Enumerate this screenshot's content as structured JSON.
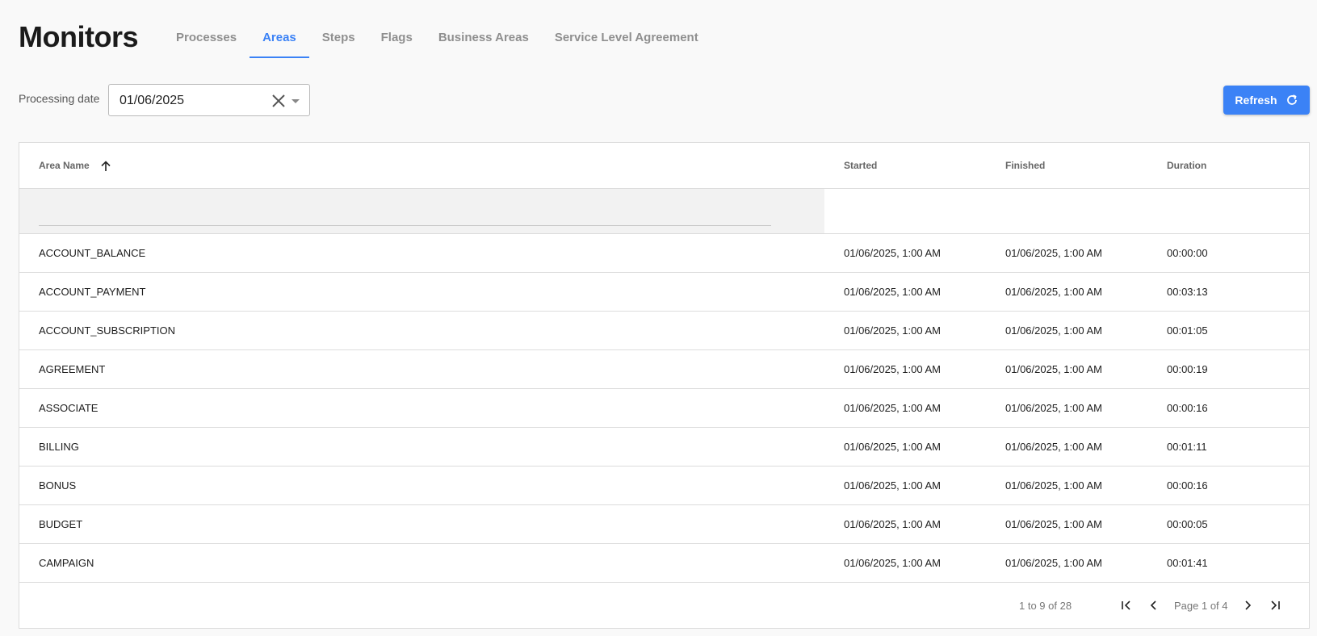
{
  "page": {
    "title": "Monitors"
  },
  "tabs": [
    {
      "label": "Processes"
    },
    {
      "label": "Areas",
      "active": true
    },
    {
      "label": "Steps"
    },
    {
      "label": "Flags"
    },
    {
      "label": "Business Areas"
    },
    {
      "label": "Service Level Agreement"
    }
  ],
  "filter": {
    "label": "Processing date",
    "value": "01/06/2025"
  },
  "refresh": {
    "label": "Refresh",
    "icon": "refresh-icon"
  },
  "colors": {
    "accent": "#3b82f6"
  },
  "grid": {
    "columns": [
      {
        "label": "Area Name",
        "sort": "ascending"
      },
      {
        "label": "Started"
      },
      {
        "label": "Finished"
      },
      {
        "label": "Duration"
      }
    ],
    "rows": [
      {
        "name": "ACCOUNT_BALANCE",
        "started": "01/06/2025, 1:00 AM",
        "finished": "01/06/2025, 1:00 AM",
        "duration": "00:00:00"
      },
      {
        "name": "ACCOUNT_PAYMENT",
        "started": "01/06/2025, 1:00 AM",
        "finished": "01/06/2025, 1:00 AM",
        "duration": "00:03:13"
      },
      {
        "name": "ACCOUNT_SUBSCRIPTION",
        "started": "01/06/2025, 1:00 AM",
        "finished": "01/06/2025, 1:00 AM",
        "duration": "00:01:05"
      },
      {
        "name": "AGREEMENT",
        "started": "01/06/2025, 1:00 AM",
        "finished": "01/06/2025, 1:00 AM",
        "duration": "00:00:19"
      },
      {
        "name": "ASSOCIATE",
        "started": "01/06/2025, 1:00 AM",
        "finished": "01/06/2025, 1:00 AM",
        "duration": "00:00:16"
      },
      {
        "name": "BILLING",
        "started": "01/06/2025, 1:00 AM",
        "finished": "01/06/2025, 1:00 AM",
        "duration": "00:01:11"
      },
      {
        "name": "BONUS",
        "started": "01/06/2025, 1:00 AM",
        "finished": "01/06/2025, 1:00 AM",
        "duration": "00:00:16"
      },
      {
        "name": "BUDGET",
        "started": "01/06/2025, 1:00 AM",
        "finished": "01/06/2025, 1:00 AM",
        "duration": "00:00:05"
      },
      {
        "name": "CAMPAIGN",
        "started": "01/06/2025, 1:00 AM",
        "finished": "01/06/2025, 1:00 AM",
        "duration": "00:01:41"
      }
    ]
  },
  "pagination": {
    "summary": "1 to 9 of 28",
    "page_label": "Page 1 of 4",
    "current_page": 1,
    "total_pages": 4
  }
}
